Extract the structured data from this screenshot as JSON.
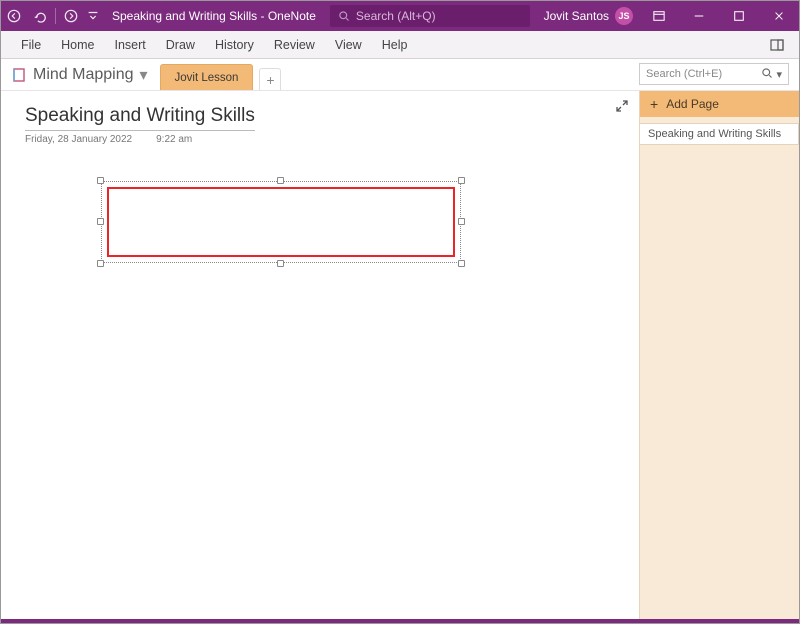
{
  "titlebar": {
    "doc_title": "Speaking and Writing Skills",
    "app_suffix": "  -  OneNote",
    "search_placeholder": "Search (Alt+Q)",
    "user_name": "Jovit Santos",
    "user_initials": "JS"
  },
  "ribbon": {
    "tabs": [
      "File",
      "Home",
      "Insert",
      "Draw",
      "History",
      "Review",
      "View",
      "Help"
    ]
  },
  "section_bar": {
    "notebook_name": "Mind Mapping",
    "active_section": "Jovit Lesson",
    "search_placeholder": "Search (Ctrl+E)"
  },
  "page": {
    "title": "Speaking and Writing Skills",
    "date": "Friday, 28 January 2022",
    "time": "9:22 am"
  },
  "sidebar": {
    "add_page_label": "Add Page",
    "pages": [
      "Speaking and Writing Skills"
    ]
  }
}
